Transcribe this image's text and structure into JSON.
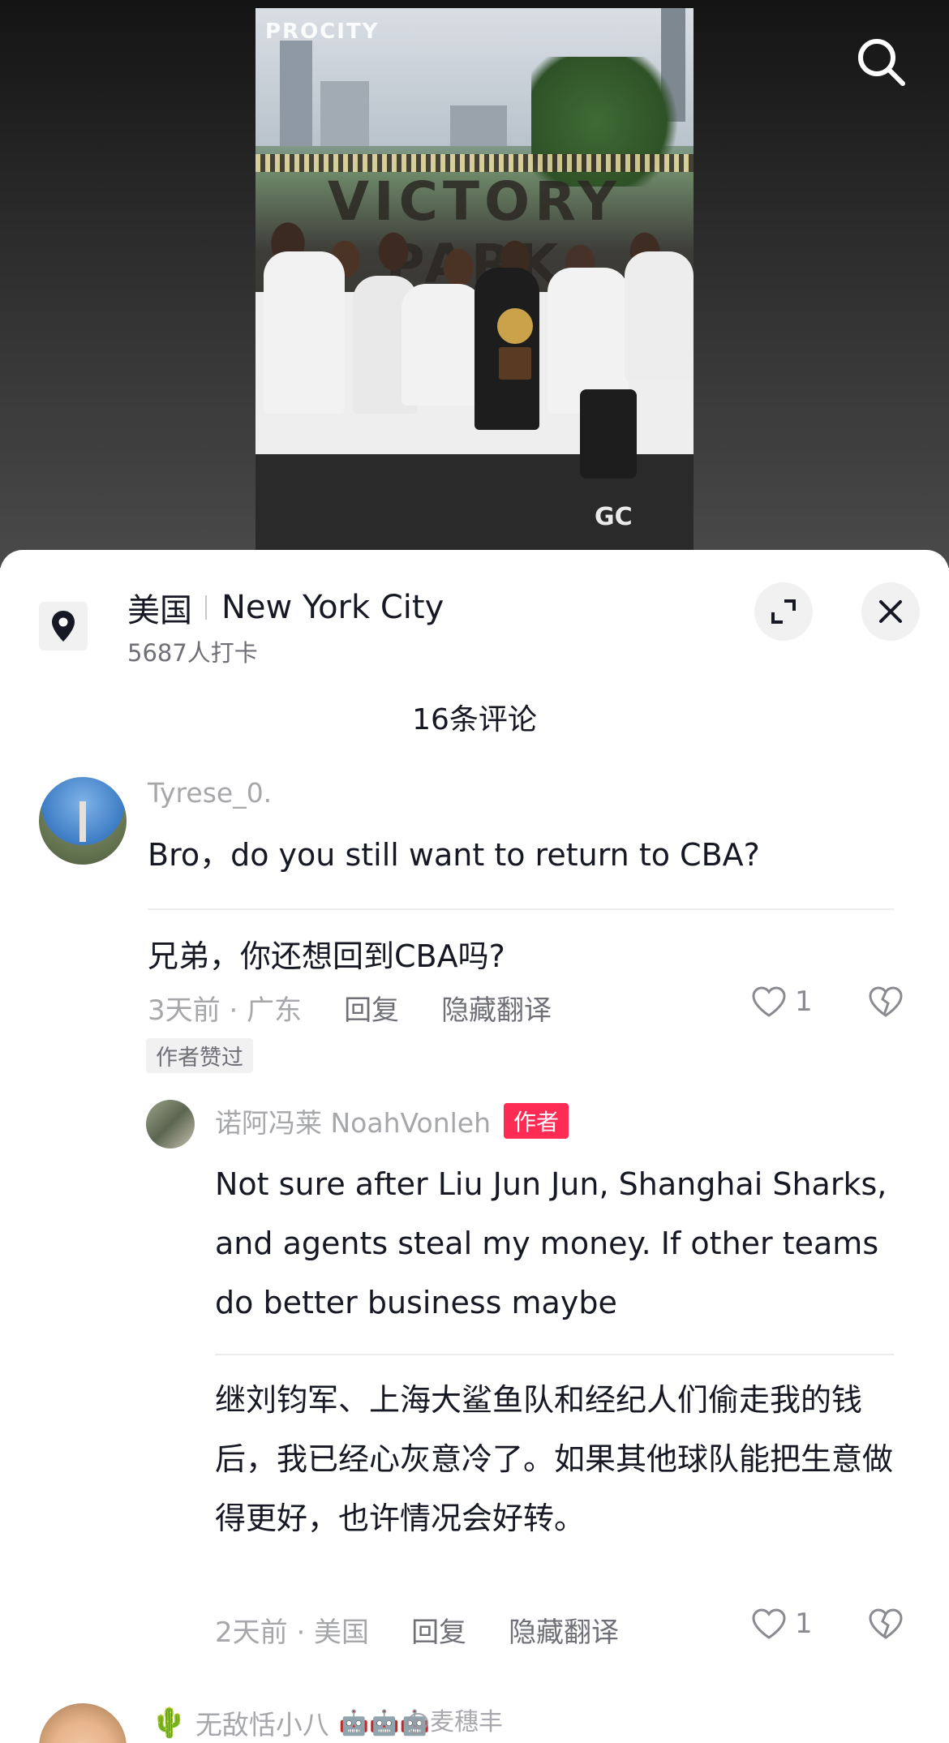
{
  "photo": {
    "brand_text": "PROCITY",
    "sign_text": "VICTORY PARK",
    "watermark_text": "GC"
  },
  "location": {
    "country": "美国",
    "city": "New York City",
    "checkins": "5687人打卡"
  },
  "comments_header": "16条评论",
  "comments": [
    {
      "username": "Tyrese_0.",
      "text": "Bro，do you still want to return to CBA?",
      "translation": "兄弟，你还想回到CBA吗?",
      "time_location": "3天前 · 广东",
      "reply_label": "回复",
      "hide_translation_label": "隐藏翻译",
      "likes": "1",
      "author_liked_tag": "作者赞过"
    },
    {
      "username": "诺阿冯莱 NoahVonleh",
      "badge": "作者",
      "text": "Not sure after Liu Jun Jun, Shanghai Sharks, and agents steal my money. If other teams do better business maybe",
      "translation": "继刘钧军、上海大鲨鱼队和经纪人们偷走我的钱后，我已经心灰意冷了。如果其他球队能把生意做得更好，也许情况会好转。",
      "time_location": "2天前 · 美国",
      "reply_label": "回复",
      "hide_translation_label": "隐藏翻译",
      "likes": "1"
    },
    {
      "username_prefix_emoji": "🌵",
      "username": "无敌恬小八",
      "suffix_emojis": "🤖🤖🤖"
    }
  ],
  "watermark": "@麦穗丰",
  "colors": {
    "accent_red": "#fe2c55",
    "text_primary": "#161823",
    "text_secondary": "#a6a7ab"
  },
  "icons": {
    "search": "search-icon",
    "location": "location-pin-icon",
    "expand": "expand-icon",
    "close": "close-icon",
    "like": "heart-icon",
    "dislike": "broken-heart-icon"
  }
}
